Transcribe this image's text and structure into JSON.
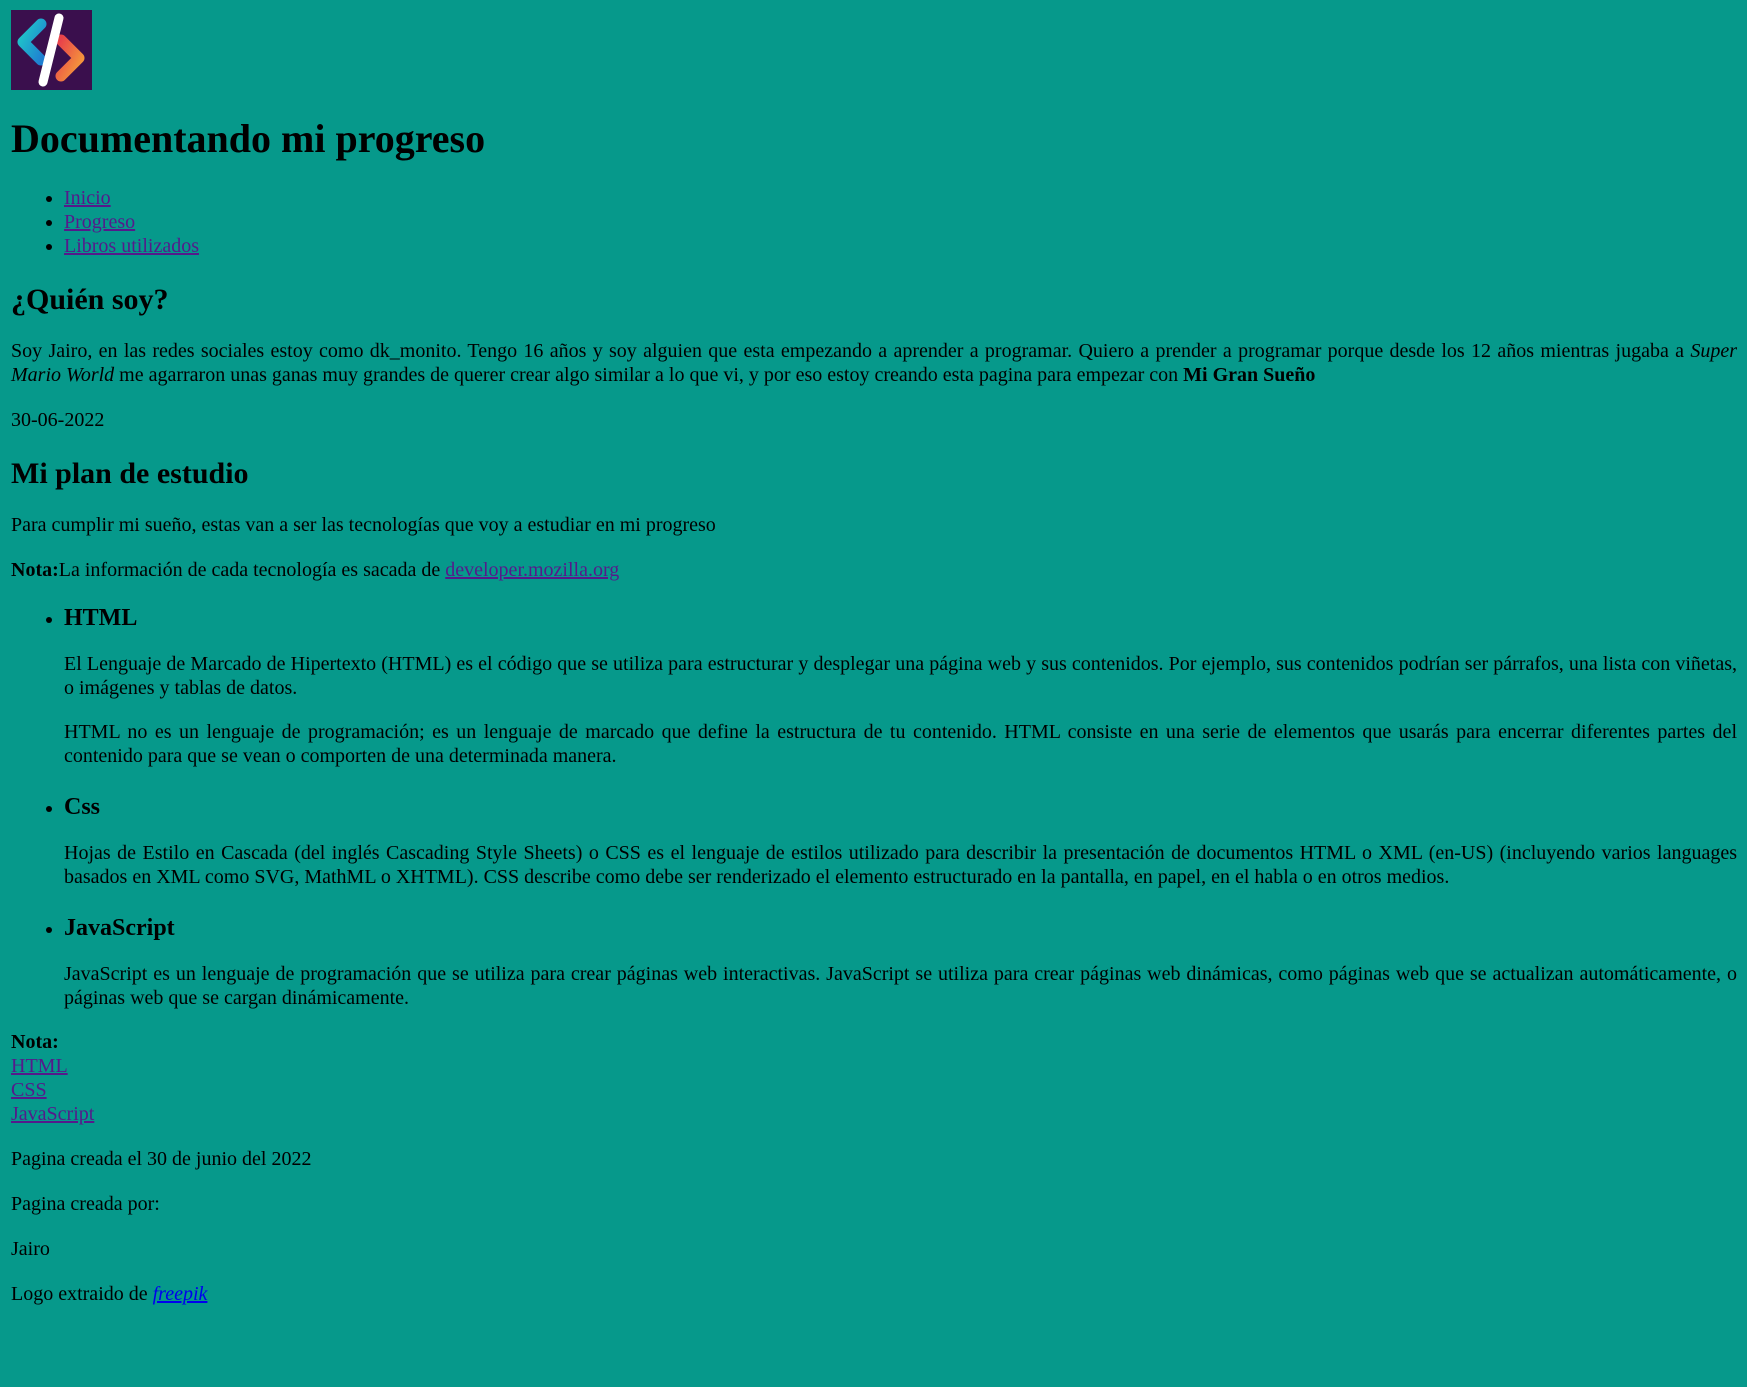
{
  "header": {
    "logo_icon": "code-slash-logo",
    "title": "Documentando mi progreso"
  },
  "nav": {
    "items": [
      {
        "label": "Inicio"
      },
      {
        "label": "Progreso"
      },
      {
        "label": "Libros utilizados"
      }
    ]
  },
  "about": {
    "heading": "¿Quién soy?",
    "text_before": "Soy Jairo, en las redes sociales estoy como dk_monito. Tengo 16 años y soy alguien que esta empezando a aprender a programar. Quiero a prender a programar porque desde los 12 años mientras jugaba a ",
    "game": "Super Mario World",
    "text_middle": " me agarraron unas ganas muy grandes de querer crear algo similar a lo que vi, y por eso estoy creando esta pagina para empezar con ",
    "dream": "Mi Gran Sueño",
    "date": "30-06-2022"
  },
  "plan": {
    "heading": "Mi plan de estudio",
    "intro": "Para cumplir mi sueño, estas van a ser las tecnologías que voy a estudiar en mi progreso",
    "note_label": "Nota:",
    "note_text": "La información de cada tecnología es sacada de ",
    "note_link": "developer.mozilla.org",
    "technologies": [
      {
        "name": "HTML",
        "paragraphs": [
          "El Lenguaje de Marcado de Hipertexto (HTML) es el código que se utiliza para estructurar y desplegar una página web y sus contenidos. Por ejemplo, sus contenidos podrían ser párrafos, una lista con viñetas, o imágenes y tablas de datos.",
          "HTML no es un lenguaje de programación; es un lenguaje de marcado que define la estructura de tu contenido. HTML consiste en una serie de elementos que usarás para encerrar diferentes partes del contenido para que se vean o comporten de una determinada manera."
        ]
      },
      {
        "name": "Css",
        "paragraphs": [
          "Hojas de Estilo en Cascada (del inglés Cascading Style Sheets) o CSS es el lenguaje de estilos utilizado para describir la presentación de documentos HTML o XML (en-US) (incluyendo varios languages basados en XML como SVG, MathML o XHTML). CSS describe como debe ser renderizado el elemento estructurado en la pantalla, en papel, en el habla o en otros medios."
        ]
      },
      {
        "name": "JavaScript",
        "paragraphs": [
          "JavaScript es un lenguaje de programación que se utiliza para crear páginas web interactivas. JavaScript se utiliza para crear páginas web dinámicas, como páginas web que se actualizan automáticamente, o páginas web que se cargan dinámicamente."
        ]
      }
    ]
  },
  "footer": {
    "notes_label": "Nota:",
    "links": [
      {
        "label": "HTML"
      },
      {
        "label": "CSS"
      },
      {
        "label": "JavaScript"
      }
    ],
    "created": "Pagina creada el 30 de junio del 2022",
    "created_by_label": "Pagina creada por:",
    "author": "Jairo",
    "logo_credit_text": "Logo extraido de ",
    "logo_credit_link": "freepik"
  },
  "colors": {
    "background": "#06998b",
    "visited_link": "#551a8b",
    "link": "#0000ee"
  }
}
